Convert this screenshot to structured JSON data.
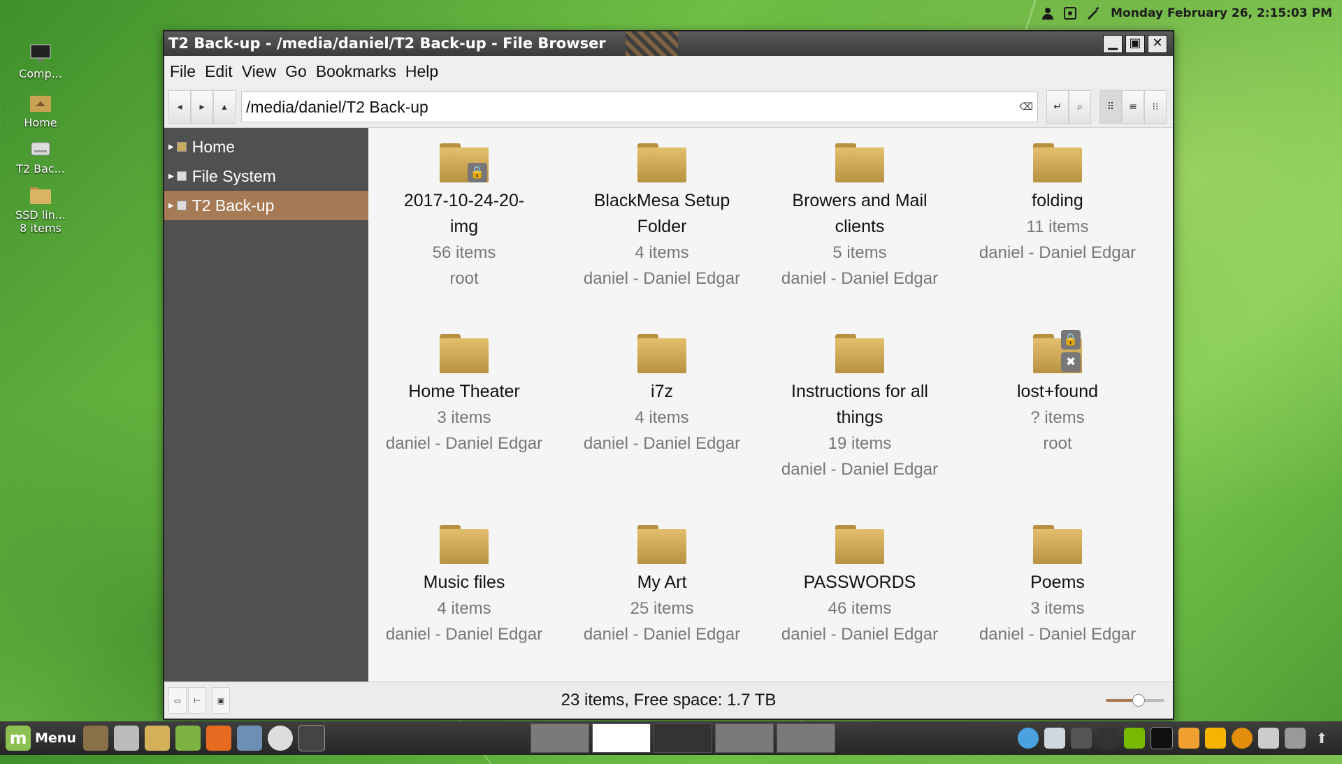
{
  "top_panel": {
    "clock": "Monday February 26,  2:15:03 PM",
    "icons": [
      "user-icon",
      "screenshot-icon",
      "pen-icon"
    ]
  },
  "desktop_icons": [
    {
      "label": "Comp...",
      "icon": "monitor-icon"
    },
    {
      "label": "Home",
      "icon": "home-folder-icon"
    },
    {
      "label": "T2 Bac...",
      "icon": "drive-icon"
    },
    {
      "label": "SSD lin...",
      "sub": "8 items",
      "icon": "folder-icon"
    }
  ],
  "window": {
    "title": "T2 Back-up - /media/daniel/T2 Back-up - File Browser",
    "buttons": {
      "minimize": "▁",
      "maximize": "▣",
      "close": "✕"
    },
    "menu": [
      "File",
      "Edit",
      "View",
      "Go",
      "Bookmarks",
      "Help"
    ],
    "location": "/media/daniel/T2 Back-up",
    "sidebar": [
      {
        "label": "Home",
        "active": false
      },
      {
        "label": "File System",
        "active": false
      },
      {
        "label": "T2 Back-up",
        "active": true
      }
    ],
    "files": [
      {
        "name": "2017-10-24-20-\nimg",
        "count": "56 items",
        "owner": "root",
        "badge": "lock"
      },
      {
        "name": "BlackMesa Setup Folder",
        "count": "4 items",
        "owner": "daniel - Daniel Edgar"
      },
      {
        "name": "Browers and Mail clients",
        "count": "5 items",
        "owner": "daniel - Daniel Edgar"
      },
      {
        "name": "folding",
        "count": "11 items",
        "owner": "daniel - Daniel Edgar"
      },
      {
        "name": "Home Theater",
        "count": "3 items",
        "owner": "daniel - Daniel Edgar"
      },
      {
        "name": "i7z",
        "count": "4 items",
        "owner": "daniel - Daniel Edgar"
      },
      {
        "name": "Instructions for all things",
        "count": "19 items",
        "owner": "daniel - Daniel Edgar"
      },
      {
        "name": "lost+found",
        "count": "? items",
        "owner": "root",
        "badge": "lock-x"
      },
      {
        "name": "Music files",
        "count": "4 items",
        "owner": "daniel - Daniel Edgar"
      },
      {
        "name": "My Art",
        "count": "25 items",
        "owner": "daniel - Daniel Edgar"
      },
      {
        "name": "PASSWORDS",
        "count": "46 items",
        "owner": "daniel - Daniel Edgar"
      },
      {
        "name": "Poems",
        "count": "3 items",
        "owner": "daniel - Daniel Edgar"
      }
    ],
    "status": "23 items, Free space: 1.7 TB",
    "zoom_level": 0.55
  },
  "bottom_panel": {
    "menu_label": "Menu"
  },
  "colors": {
    "accent": "#a57a55",
    "sidebar_bg": "#505050",
    "folder": "#d4b05a"
  }
}
